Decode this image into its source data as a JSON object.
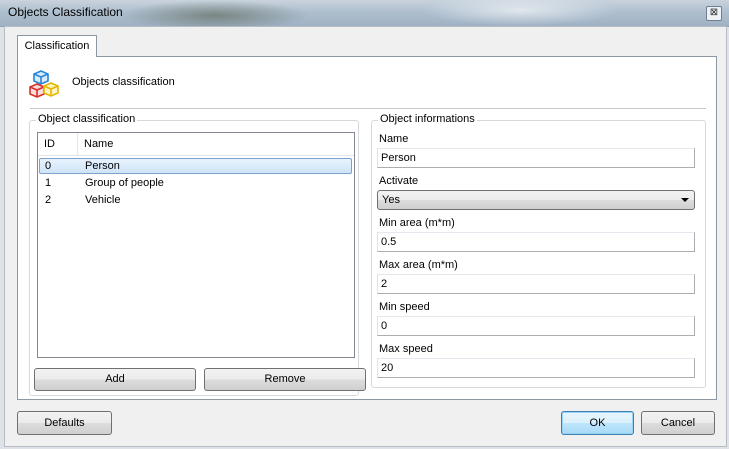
{
  "window": {
    "title": "Objects Classification",
    "close_glyph": "⊠"
  },
  "tabs": [
    {
      "label": "Classification"
    }
  ],
  "header": {
    "title": "Objects classification",
    "icon": "cubes-icon"
  },
  "object_classification": {
    "legend": "Object classification",
    "columns": {
      "id": "ID",
      "name": "Name"
    },
    "rows": [
      {
        "id": "0",
        "name": "Person",
        "selected": true
      },
      {
        "id": "1",
        "name": "Group of people",
        "selected": false
      },
      {
        "id": "2",
        "name": "Vehicle",
        "selected": false
      }
    ],
    "add_label": "Add",
    "remove_label": "Remove"
  },
  "object_informations": {
    "legend": "Object informations",
    "name_label": "Name",
    "name_value": "Person",
    "activate_label": "Activate",
    "activate_value": "Yes",
    "min_area_label": "Min area (m*m)",
    "min_area_value": "0.5",
    "max_area_label": "Max area (m*m)",
    "max_area_value": "2",
    "min_speed_label": "Min speed",
    "min_speed_value": "0",
    "max_speed_label": "Max speed",
    "max_speed_value": "20"
  },
  "footer": {
    "defaults_label": "Defaults",
    "ok_label": "OK",
    "cancel_label": "Cancel"
  },
  "colors": {
    "selection": "#cfe4f8",
    "default_button_border": "#3c7fb1"
  }
}
